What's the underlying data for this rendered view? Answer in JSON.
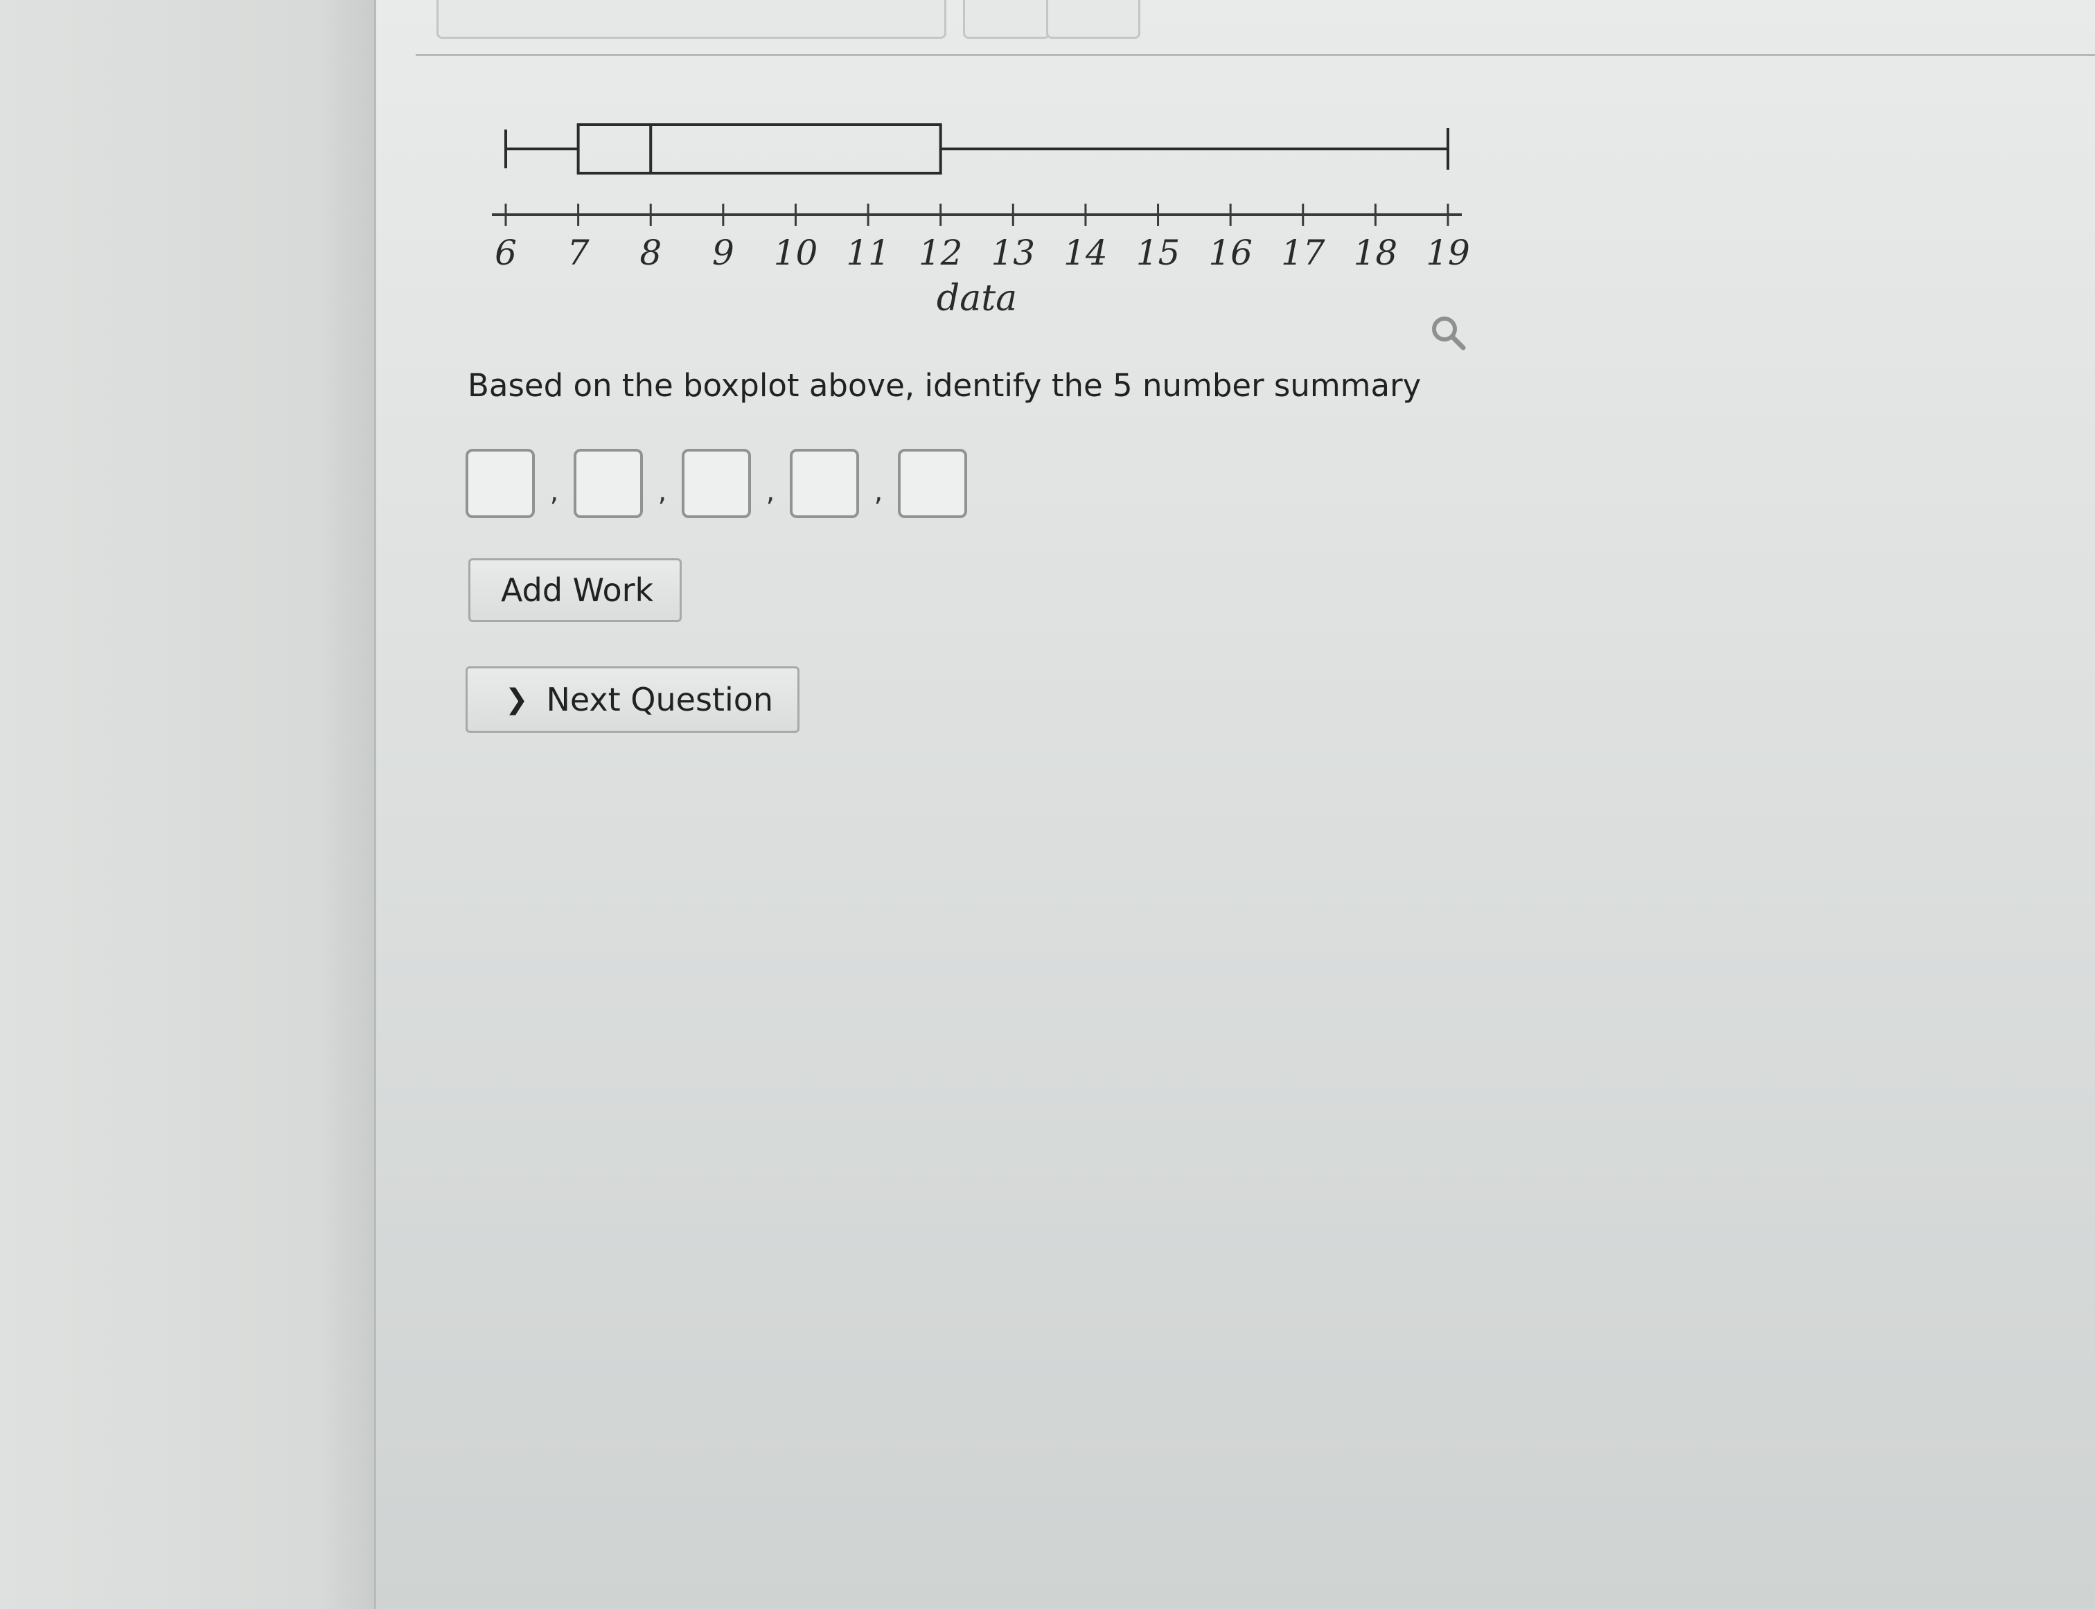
{
  "question": {
    "prompt": "Based on the boxplot above, identify the 5 number summary",
    "answer_placeholders": [
      "",
      "",
      "",
      "",
      ""
    ],
    "separator": ","
  },
  "buttons": {
    "add_work": "Add Work",
    "next_question": "Next Question"
  },
  "icons": {
    "zoom": "magnify-icon",
    "next": "chevron-right-icon"
  },
  "chart_data": {
    "type": "boxplot",
    "xlabel": "data",
    "ticks": [
      6,
      7,
      8,
      9,
      10,
      11,
      12,
      13,
      14,
      15,
      16,
      17,
      18,
      19
    ],
    "xlim": [
      6,
      19
    ],
    "box": {
      "min": 6,
      "q1": 7,
      "median": 8,
      "q3": 12,
      "max": 19
    },
    "outliers": [],
    "grid": false
  }
}
